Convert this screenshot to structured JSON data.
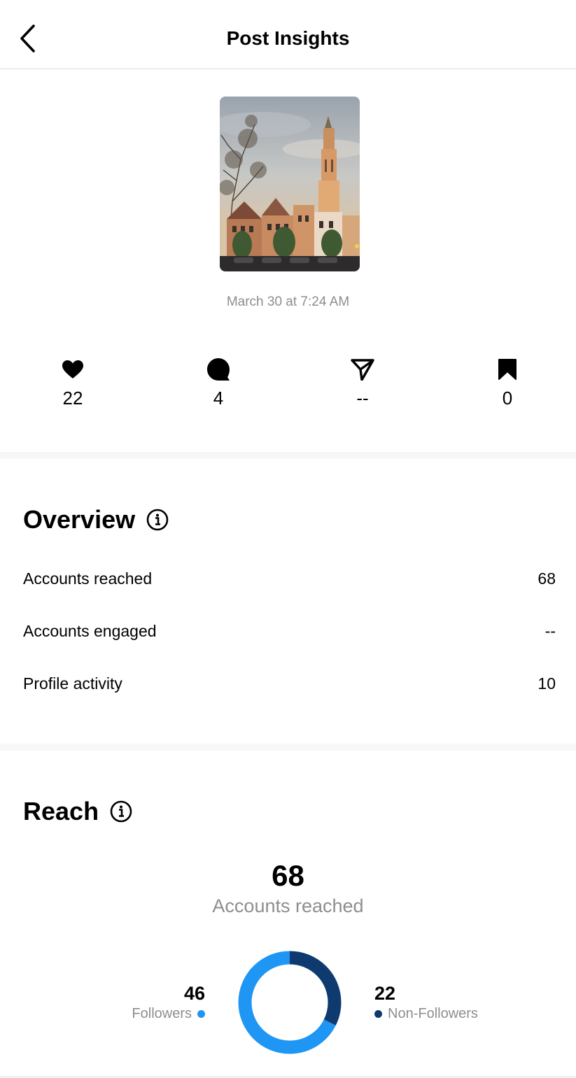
{
  "header": {
    "title": "Post Insights",
    "back_icon": "chevron-left-icon"
  },
  "post": {
    "date": "March 30 at 7:24 AM",
    "image_alt": "Church tower with houses at sunset"
  },
  "stats": {
    "likes": {
      "icon": "heart-icon",
      "value": "22"
    },
    "comments": {
      "icon": "comment-icon",
      "value": "4"
    },
    "shares": {
      "icon": "send-icon",
      "value": "--"
    },
    "saves": {
      "icon": "bookmark-icon",
      "value": "0"
    }
  },
  "overview": {
    "title": "Overview",
    "rows": [
      {
        "label": "Accounts reached",
        "value": "68"
      },
      {
        "label": "Accounts engaged",
        "value": "--"
      },
      {
        "label": "Profile activity",
        "value": "10"
      }
    ]
  },
  "reach": {
    "title": "Reach",
    "total": "68",
    "total_label": "Accounts reached",
    "followers": {
      "value": "46",
      "label": "Followers",
      "color": "#1f96f3"
    },
    "non_followers": {
      "value": "22",
      "label": "Non-Followers",
      "color": "#0f3a70"
    }
  }
}
